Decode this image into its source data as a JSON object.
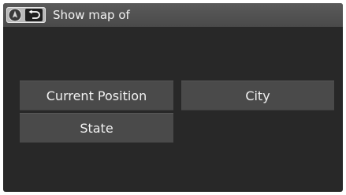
{
  "header": {
    "title": "Show map of",
    "map_icon": "map-pin-icon",
    "back_icon": "back-arrow-icon"
  },
  "menu": {
    "current_position": "Current Position",
    "city": "City",
    "state": "State"
  },
  "colors": {
    "screen_background": "#282828",
    "header_background": "#505050",
    "button_background": "#4a4a4a",
    "text": "#f2f2f2"
  }
}
